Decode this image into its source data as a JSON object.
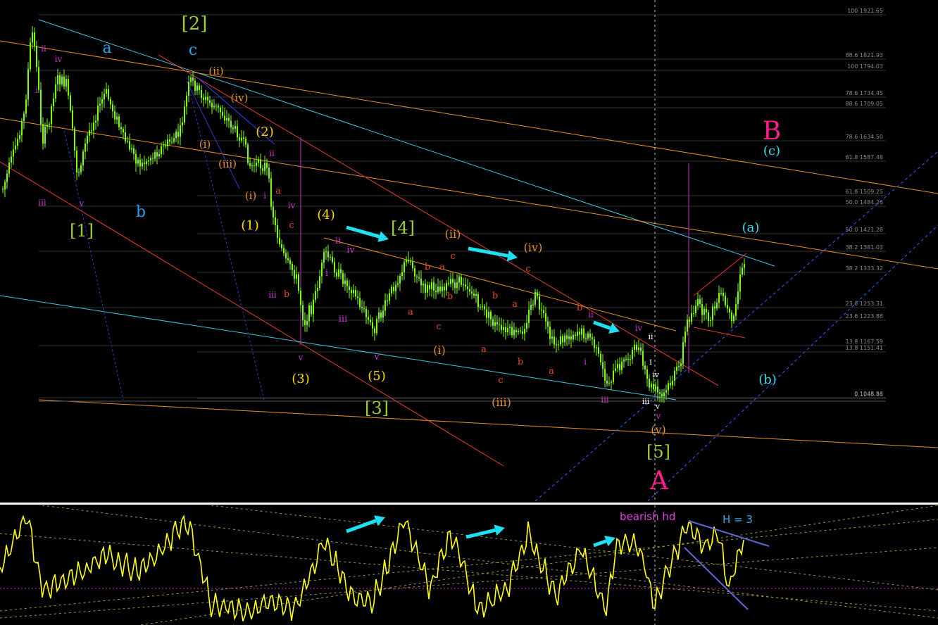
{
  "chart_data": {
    "type": "candlestick",
    "price_ylim": [
      900,
      2000
    ],
    "fib_levels": [
      {
        "text": "100 1921.65",
        "value": 1921.65
      },
      {
        "text": "88.6 1821.93",
        "value": 1821.93
      },
      {
        "text": "100 1794.03",
        "value": 1794.03
      },
      {
        "text": "78.6 1734.45",
        "value": 1734.45
      },
      {
        "text": "88.6 1709.05",
        "value": 1709.05
      },
      {
        "text": "78.6 1634.50",
        "value": 1634.5
      },
      {
        "text": "61.8 1587.48",
        "value": 1587.48
      },
      {
        "text": "61.8 1509.25",
        "value": 1509.25
      },
      {
        "text": "50.0 1484.26",
        "value": 1484.26
      },
      {
        "text": "50.0 1421.28",
        "value": 1421.28
      },
      {
        "text": "38.2 1381.03",
        "value": 1381.03
      },
      {
        "text": "38.2 1333.32",
        "value": 1333.32
      },
      {
        "text": "23.6 1253.31",
        "value": 1253.31
      },
      {
        "text": "23.6 1223.88",
        "value": 1223.88
      },
      {
        "text": "13.8 1167.59",
        "value": 1167.59
      },
      {
        "text": "13.8 1151.41",
        "value": 1151.41
      },
      {
        "text": "0 1048.53",
        "value": 1048.53
      },
      {
        "text": "0.1046.86",
        "value": 1046.86
      }
    ],
    "wave_labels": [
      {
        "text": "[2]",
        "color": "#9acd32"
      },
      {
        "text": "a",
        "color": "#29a3e8"
      },
      {
        "text": "c",
        "color": "#29a3e8"
      },
      {
        "text": "b",
        "color": "#29a3e8"
      },
      {
        "text": "[1]",
        "color": "#9acd32"
      },
      {
        "text": "[3]",
        "color": "#9acd32"
      },
      {
        "text": "[4]",
        "color": "#9acd32"
      },
      {
        "text": "[5]",
        "color": "#9acd32"
      },
      {
        "text": "(1)",
        "color": "#ffd700"
      },
      {
        "text": "(2)",
        "color": "#ffd700"
      },
      {
        "text": "(3)",
        "color": "#ffd700"
      },
      {
        "text": "(4)",
        "color": "#ffd700"
      },
      {
        "text": "(5)",
        "color": "#ffd700"
      },
      {
        "text": "(i)",
        "color": "#e8902a"
      },
      {
        "text": "(ii)",
        "color": "#e8902a"
      },
      {
        "text": "(iii)",
        "color": "#e8902a"
      },
      {
        "text": "(iv)",
        "color": "#e8902a"
      },
      {
        "text": "(v)",
        "color": "#e8902a"
      },
      {
        "text": "A",
        "color": "#ff1e8c"
      },
      {
        "text": "B",
        "color": "#ff1e8c"
      },
      {
        "text": "(a)",
        "color": "#40e0f0"
      },
      {
        "text": "(b)",
        "color": "#40e0f0"
      },
      {
        "text": "(c)",
        "color": "#40e0f0"
      },
      {
        "text": "i",
        "color": "#cc33cc"
      },
      {
        "text": "ii",
        "color": "#cc33cc"
      },
      {
        "text": "iii",
        "color": "#cc33cc"
      },
      {
        "text": "iv",
        "color": "#cc33cc"
      },
      {
        "text": "v",
        "color": "#cc33cc"
      },
      {
        "text": "a",
        "color": "#e84a1e"
      },
      {
        "text": "b",
        "color": "#e84a1e"
      },
      {
        "text": "c",
        "color": "#e84a1e"
      }
    ],
    "oscillator_annotations": [
      {
        "text": "bearish hd",
        "color": "#e040e0"
      },
      {
        "text": "H = 3",
        "color": "#3aa8e8"
      }
    ],
    "colors": {
      "candle": "#7fff00",
      "oscillator": "#ffff1a",
      "fib_line": "#3a3a3a",
      "separator": "#ffffff"
    }
  }
}
